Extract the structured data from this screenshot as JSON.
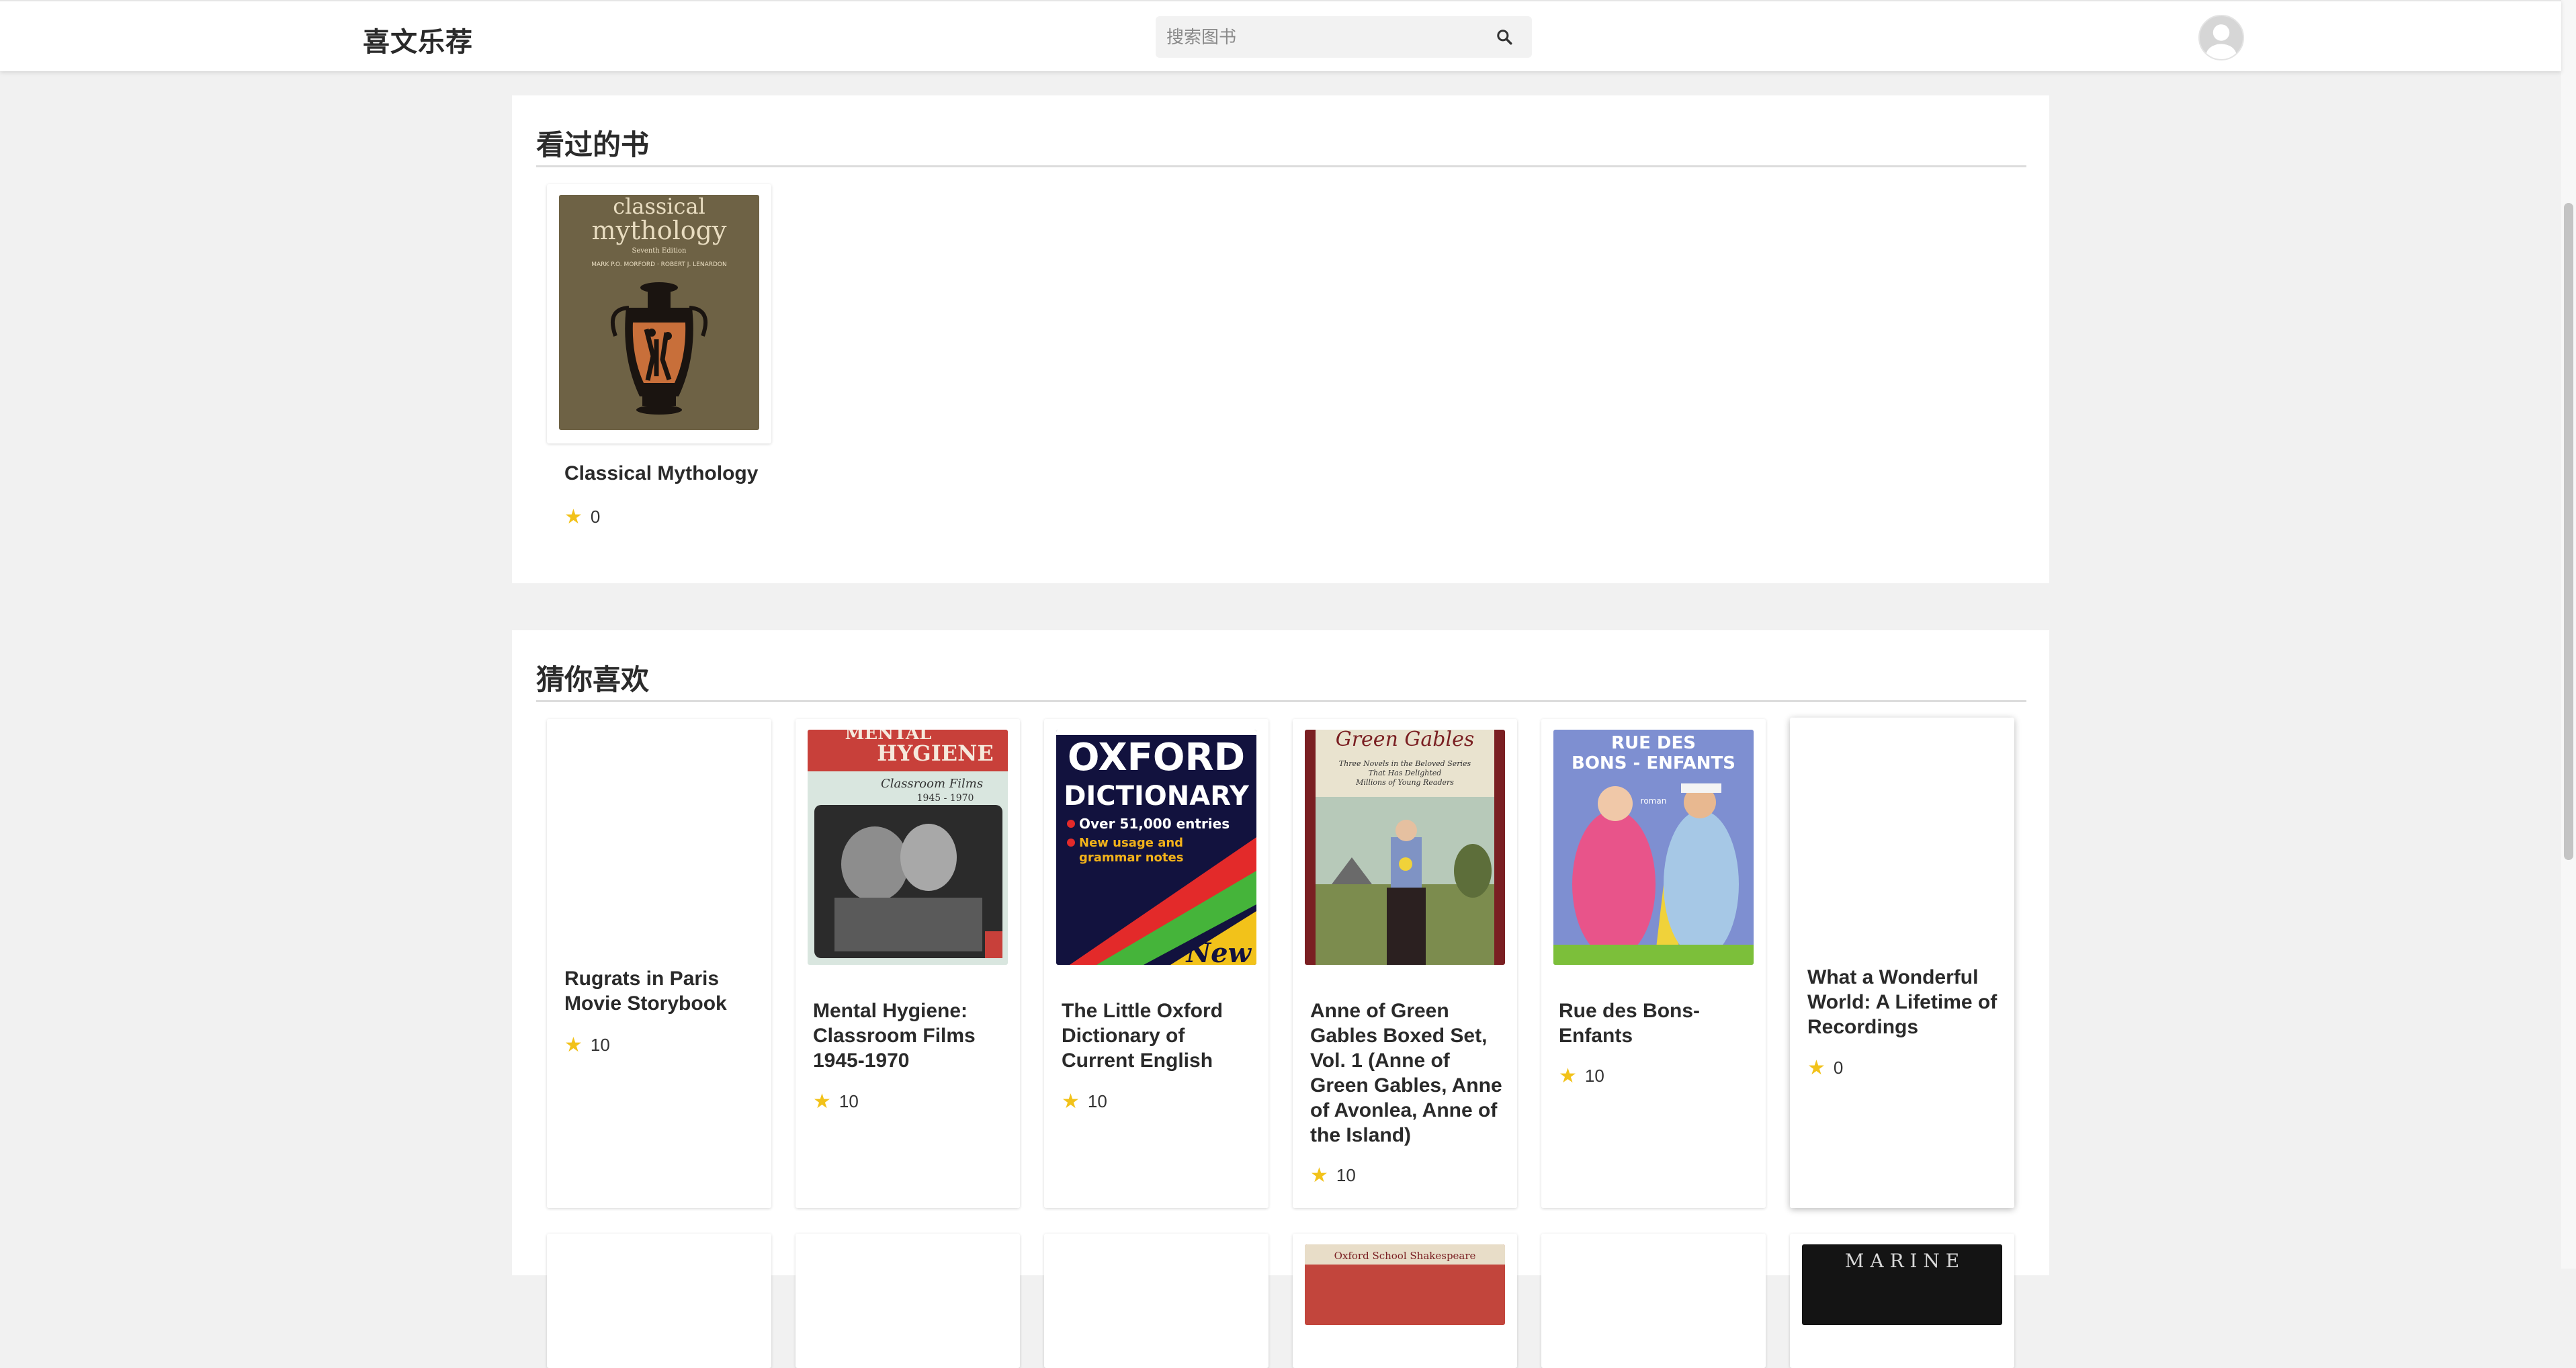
{
  "header": {
    "brand": "喜文乐荐",
    "search_placeholder": "搜索图书",
    "search_value": ""
  },
  "sections": {
    "viewed": {
      "title": "看过的书",
      "books": [
        {
          "title": "Classical Mythology",
          "rating": "0",
          "cover": "classical-mythology"
        }
      ]
    },
    "recommended": {
      "title": "猜你喜欢",
      "books": [
        {
          "title": "Rugrats in Paris Movie Storybook",
          "rating": "10",
          "cover": "none"
        },
        {
          "title": "Mental Hygiene: Classroom Films 1945-1970",
          "rating": "10",
          "cover": "mental-hygiene"
        },
        {
          "title": "The Little Oxford Dictionary of Current English",
          "rating": "10",
          "cover": "oxford-dictionary"
        },
        {
          "title": "Anne of Green Gables Boxed Set, Vol. 1 (Anne of Green Gables, Anne of Avonlea, Anne of the Island)",
          "rating": "10",
          "cover": "green-gables"
        },
        {
          "title": "Rue des Bons-Enfants",
          "rating": "10",
          "cover": "rue-des-bons-enfants"
        },
        {
          "title": "What a Wonderful World: A Lifetime of Recordings",
          "rating": "0",
          "cover": "none"
        }
      ]
    }
  },
  "covers": {
    "classical_mythology": {
      "line1": "classical",
      "line2": "mythology",
      "edition": "Seventh Edition",
      "authors": "MARK P.O. MORFORD · ROBERT J. LENARDON"
    },
    "mental_hygiene": {
      "title": "HYGIENE",
      "top": "MENTAL",
      "sub": "Classroom Films",
      "years": "1945 - 1970"
    },
    "oxford": {
      "line1": "OXFORD",
      "line2": "DICTIONARY",
      "entries": "Over 51,000 entries",
      "notes1": "New usage and",
      "notes2": "grammar notes",
      "new": "New"
    },
    "green_gables": {
      "title": "Green Gables",
      "tag1": "Three Novels in the Beloved Series",
      "tag2": "That Has Delighted",
      "tag3": "Millions of Young Readers"
    },
    "rue": {
      "line1": "RUE DES",
      "line2": "BONS - ENFANTS",
      "genre": "roman"
    },
    "partial": {
      "shakespeare": "Oxford School Shakespeare",
      "marine": "M A R I N E"
    }
  },
  "colors": {
    "page_bg": "#f1f1f1",
    "card_bg": "#ffffff",
    "star": "#f2c21a",
    "title_text": "#2a2a2a"
  }
}
